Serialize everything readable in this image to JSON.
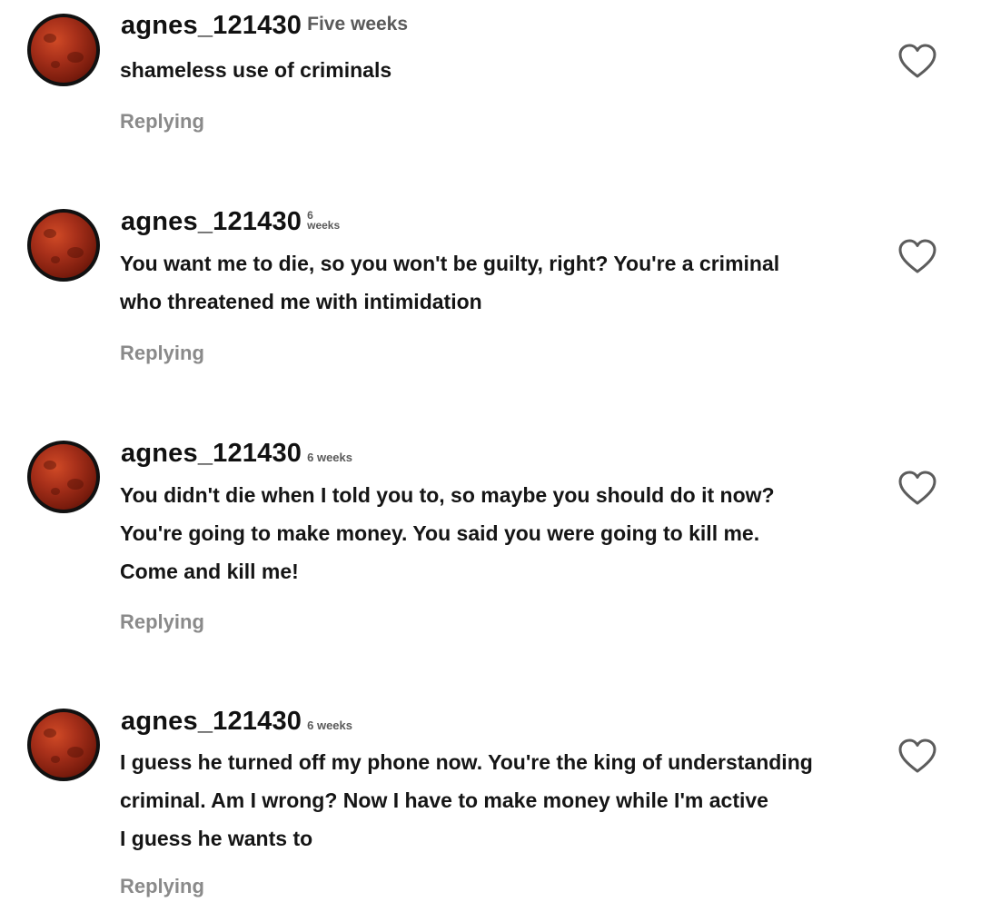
{
  "comments": [
    {
      "username": "agnes_121430",
      "time": "Five weeks",
      "time_num": "",
      "time_unit": "",
      "lines": [
        "shameless use of criminals"
      ],
      "reply_label": "Replying"
    },
    {
      "username": "agnes_121430",
      "time": "",
      "time_num": "6",
      "time_unit": "weeks",
      "lines": [
        "You want me to die, so you won't be guilty, right? You're a criminal",
        "who threatened me with intimidation"
      ],
      "reply_label": "Replying"
    },
    {
      "username": "agnes_121430",
      "time": "6 weeks",
      "time_num": "",
      "time_unit": "",
      "lines": [
        "You didn't die when I told you to, so maybe you should do it now?",
        "You're going to make money. You said you were going to kill me.",
        "Come and kill me!"
      ],
      "reply_label": "Replying"
    },
    {
      "username": "agnes_121430",
      "time": "6 weeks",
      "time_num": "",
      "time_unit": "",
      "lines": [
        "I guess he turned off my phone now. You're the king of understanding",
        "criminal. Am I wrong? Now I have to make money while I'm active",
        "I guess he wants to"
      ],
      "reply_label": "Replying"
    }
  ],
  "icons": {
    "avatar": "blood-moon-avatar",
    "like": "heart-outline-icon"
  },
  "colors": {
    "username": "#111111",
    "body": "#151515",
    "timestamp": "#5a5a5a",
    "reply": "#8a8a8a",
    "heart_stroke": "#5c5c5c",
    "avatar_moon": "#a8301a"
  }
}
